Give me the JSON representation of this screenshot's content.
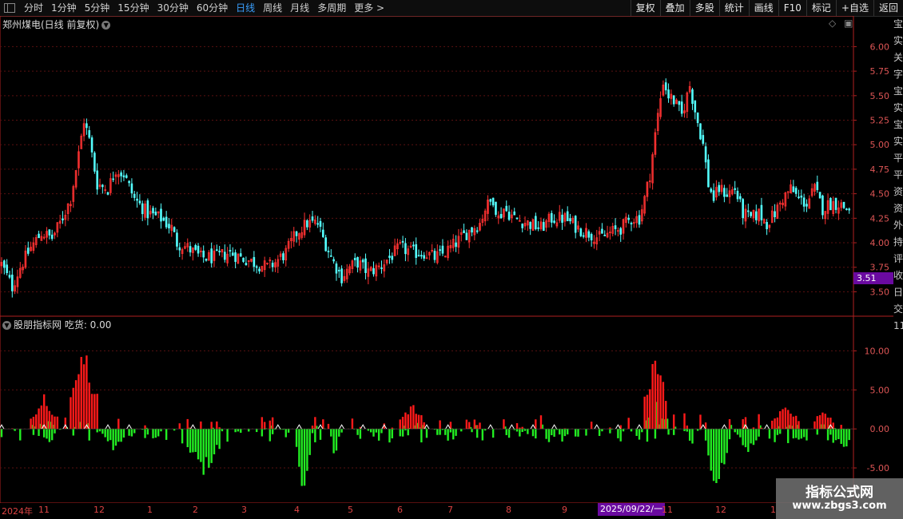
{
  "toolbar": {
    "timeframes": [
      "分时",
      "1分钟",
      "5分钟",
      "15分钟",
      "30分钟",
      "60分钟",
      "日线",
      "周线",
      "月线",
      "多周期",
      "更多 >"
    ],
    "active_timeframe": "日线",
    "buttons": [
      "复权",
      "叠加",
      "多股",
      "统计",
      "画线",
      "F10",
      "标记",
      "+自选",
      "返回"
    ]
  },
  "main_panel": {
    "title": "郑州煤电(日线 前复权)",
    "price_tag": "3.51"
  },
  "indicator_panel": {
    "title": "股朋指标网 吃货: 0.00"
  },
  "date_axis": {
    "labels": [
      "2024年",
      "11",
      "12",
      "1",
      "2",
      "3",
      "4",
      "5",
      "6",
      "7",
      "8",
      "9",
      "11",
      "12",
      "1"
    ],
    "cursor_label": "2025/09/22/一"
  },
  "side_strip_text": "宝实关字宝实宝实平平资资外持评收日交1111111",
  "watermark": {
    "title": "指标公式网",
    "url": "www.zbgs3.com"
  },
  "colors": {
    "up": "#ff3232",
    "down": "#54ffff",
    "bar_up": "#ff1a1a",
    "bar_down": "#22ee22",
    "axis": "#b02020",
    "grid": "#5a1010"
  },
  "chart_data": [
    {
      "type": "candlestick",
      "title": "郑州煤电(日线 前复权)",
      "ylim": [
        3.3,
        6.15
      ],
      "y_ticks": [
        3.5,
        3.75,
        4.0,
        4.25,
        4.5,
        4.75,
        5.0,
        5.25,
        5.5,
        5.75,
        6.0
      ],
      "y_tick_labels": [
        "3.50",
        "3.75",
        "4.00",
        "4.25",
        "4.50",
        "4.75",
        "5.00",
        "5.25",
        "5.50",
        "5.75",
        "6.00"
      ],
      "close_path": [
        [
          0,
          3.78
        ],
        [
          8,
          3.55
        ],
        [
          14,
          3.75
        ],
        [
          22,
          3.95
        ],
        [
          30,
          4.1
        ],
        [
          38,
          4.05
        ],
        [
          44,
          4.2
        ],
        [
          52,
          4.45
        ],
        [
          58,
          4.9
        ],
        [
          62,
          5.25
        ],
        [
          66,
          5.05
        ],
        [
          72,
          4.6
        ],
        [
          80,
          4.55
        ],
        [
          86,
          4.75
        ],
        [
          92,
          4.7
        ],
        [
          100,
          4.45
        ],
        [
          110,
          4.3
        ],
        [
          120,
          4.25
        ],
        [
          128,
          4.15
        ],
        [
          132,
          4.0
        ],
        [
          140,
          3.95
        ],
        [
          150,
          3.85
        ],
        [
          160,
          3.85
        ],
        [
          172,
          3.9
        ],
        [
          180,
          3.85
        ],
        [
          190,
          3.8
        ],
        [
          200,
          3.75
        ],
        [
          206,
          3.8
        ],
        [
          214,
          3.9
        ],
        [
          222,
          4.1
        ],
        [
          230,
          4.2
        ],
        [
          238,
          4.2
        ],
        [
          242,
          4.05
        ],
        [
          250,
          3.8
        ],
        [
          256,
          3.65
        ],
        [
          262,
          3.75
        ],
        [
          268,
          3.8
        ],
        [
          276,
          3.7
        ],
        [
          284,
          3.75
        ],
        [
          292,
          3.85
        ],
        [
          300,
          3.95
        ],
        [
          310,
          3.9
        ],
        [
          318,
          3.9
        ],
        [
          326,
          3.85
        ],
        [
          334,
          3.9
        ],
        [
          342,
          4.0
        ],
        [
          350,
          4.1
        ],
        [
          360,
          4.2
        ],
        [
          364,
          4.35
        ],
        [
          370,
          4.45
        ],
        [
          374,
          4.25
        ],
        [
          378,
          4.35
        ],
        [
          386,
          4.25
        ],
        [
          396,
          4.2
        ],
        [
          406,
          4.15
        ],
        [
          414,
          4.25
        ],
        [
          424,
          4.25
        ],
        [
          434,
          4.15
        ],
        [
          442,
          4.1
        ],
        [
          450,
          4.05
        ],
        [
          458,
          4.1
        ],
        [
          466,
          4.15
        ],
        [
          474,
          4.25
        ],
        [
          480,
          4.25
        ],
        [
          484,
          4.45
        ],
        [
          488,
          4.7
        ],
        [
          494,
          5.3
        ],
        [
          498,
          5.65
        ],
        [
          502,
          5.5
        ],
        [
          506,
          5.45
        ],
        [
          512,
          5.3
        ],
        [
          518,
          5.6
        ],
        [
          522,
          5.35
        ],
        [
          528,
          5.0
        ],
        [
          532,
          4.6
        ],
        [
          536,
          4.45
        ],
        [
          540,
          4.55
        ],
        [
          546,
          4.5
        ],
        [
          552,
          4.55
        ],
        [
          558,
          4.3
        ],
        [
          564,
          4.25
        ],
        [
          570,
          4.3
        ],
        [
          576,
          4.2
        ],
        [
          582,
          4.3
        ],
        [
          588,
          4.45
        ],
        [
          594,
          4.55
        ],
        [
          600,
          4.45
        ],
        [
          606,
          4.4
        ],
        [
          612,
          4.55
        ],
        [
          618,
          4.35
        ],
        [
          624,
          4.4
        ],
        [
          630,
          4.4
        ],
        [
          636,
          4.35
        ]
      ],
      "x_count": 640
    },
    {
      "type": "bar",
      "title": "股朋指标网 吃货: 0.00",
      "ylim": [
        -9.5,
        12.5
      ],
      "y_ticks": [
        -5.0,
        0.0,
        5.0,
        10.0
      ],
      "y_tick_labels": [
        "-5.00",
        "0.00",
        "5.00",
        "10.00"
      ],
      "up_segments": [
        [
          22,
          42,
          4.5
        ],
        [
          52,
          72,
          11.5
        ],
        [
          300,
          318,
          3.5
        ],
        [
          484,
          500,
          12.0
        ],
        [
          580,
          600,
          3.5
        ],
        [
          612,
          626,
          3.0
        ]
      ],
      "down_segments": [
        [
          78,
          92,
          -3.0
        ],
        [
          140,
          164,
          -6.5
        ],
        [
          222,
          232,
          -8.5
        ],
        [
          248,
          254,
          -4.0
        ],
        [
          532,
          546,
          -9.5
        ],
        [
          554,
          570,
          -3.0
        ],
        [
          630,
          640,
          -3.5
        ]
      ],
      "x_count": 640
    }
  ]
}
